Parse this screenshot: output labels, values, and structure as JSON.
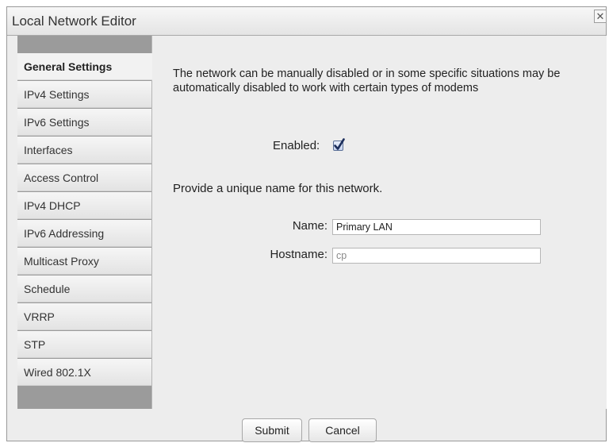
{
  "window": {
    "title": "Local Network Editor",
    "close_glyph": "✕"
  },
  "sidebar": {
    "items": [
      {
        "label": "General Settings",
        "active": true
      },
      {
        "label": "IPv4 Settings"
      },
      {
        "label": "IPv6 Settings"
      },
      {
        "label": "Interfaces"
      },
      {
        "label": "Access Control"
      },
      {
        "label": "IPv4 DHCP"
      },
      {
        "label": "IPv6 Addressing"
      },
      {
        "label": "Multicast Proxy"
      },
      {
        "label": "Schedule"
      },
      {
        "label": "VRRP"
      },
      {
        "label": "STP"
      },
      {
        "label": "Wired 802.1X"
      }
    ]
  },
  "general": {
    "description": "The network can be manually disabled or in some specific situations may be automatically disabled to work with certain types of modems",
    "enabled_label": "Enabled:",
    "enabled_checked": true,
    "name_prompt": "Provide a unique name for this network.",
    "name_label": "Name:",
    "name_value": "Primary LAN",
    "hostname_label": "Hostname:",
    "hostname_value": "cp"
  },
  "footer": {
    "submit_label": "Submit",
    "cancel_label": "Cancel"
  }
}
